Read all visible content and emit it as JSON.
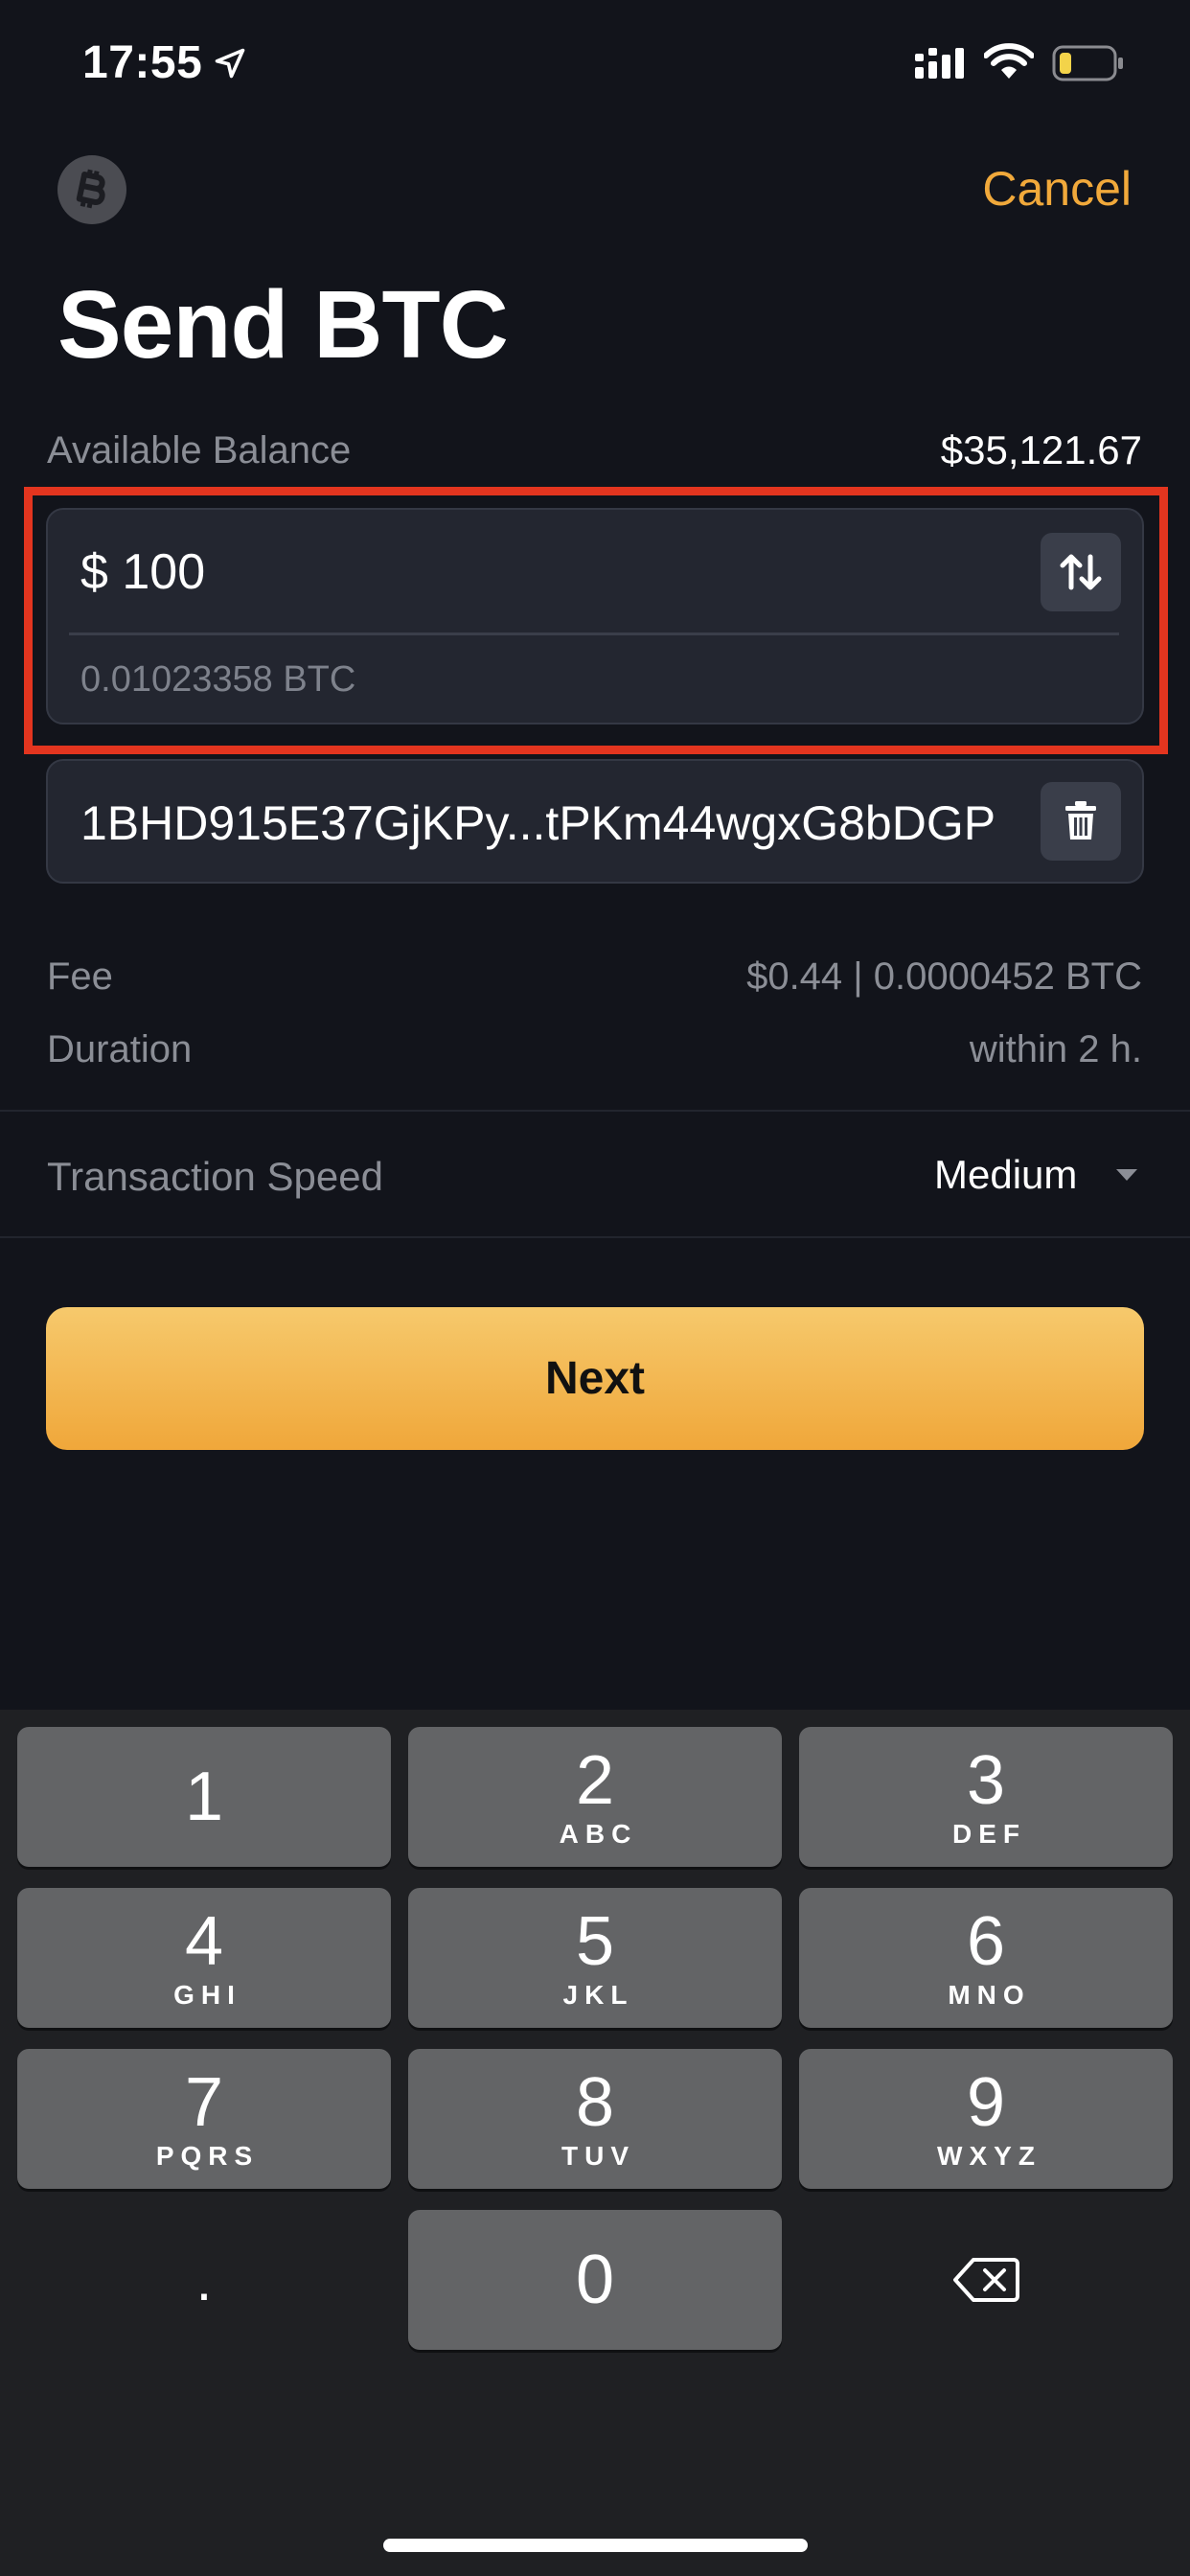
{
  "status_bar": {
    "time": "17:55"
  },
  "header": {
    "cancel_label": "Cancel",
    "title": "Send BTC"
  },
  "balance": {
    "label": "Available Balance",
    "value": "$35,121.67"
  },
  "amount": {
    "fiat_value": "$ 100",
    "btc_value": "0.01023358 BTC"
  },
  "address": {
    "value": "1BHD915E37GjKPy...tPKm44wgxG8bDGP"
  },
  "fee": {
    "label": "Fee",
    "value": "$0.44 | 0.0000452 BTC"
  },
  "duration": {
    "label": "Duration",
    "value": "within 2 h."
  },
  "speed": {
    "label": "Transaction Speed",
    "value": "Medium"
  },
  "next_label": "Next",
  "keyboard": {
    "keys": [
      {
        "num": "1",
        "letters": ""
      },
      {
        "num": "2",
        "letters": "ABC"
      },
      {
        "num": "3",
        "letters": "DEF"
      },
      {
        "num": "4",
        "letters": "GHI"
      },
      {
        "num": "5",
        "letters": "JKL"
      },
      {
        "num": "6",
        "letters": "MNO"
      },
      {
        "num": "7",
        "letters": "PQRS"
      },
      {
        "num": "8",
        "letters": "TUV"
      },
      {
        "num": "9",
        "letters": "WXYZ"
      },
      {
        "num": "0",
        "letters": ""
      }
    ],
    "dot": "."
  },
  "colors": {
    "accent": "#f1a93b",
    "highlight": "#e3351f",
    "background": "#12141b"
  },
  "icons": [
    "location-arrow-icon",
    "signal-icon",
    "wifi-icon",
    "battery-icon",
    "bitcoin-icon",
    "swap-arrows-icon",
    "trash-icon",
    "caret-down-icon",
    "backspace-icon"
  ]
}
